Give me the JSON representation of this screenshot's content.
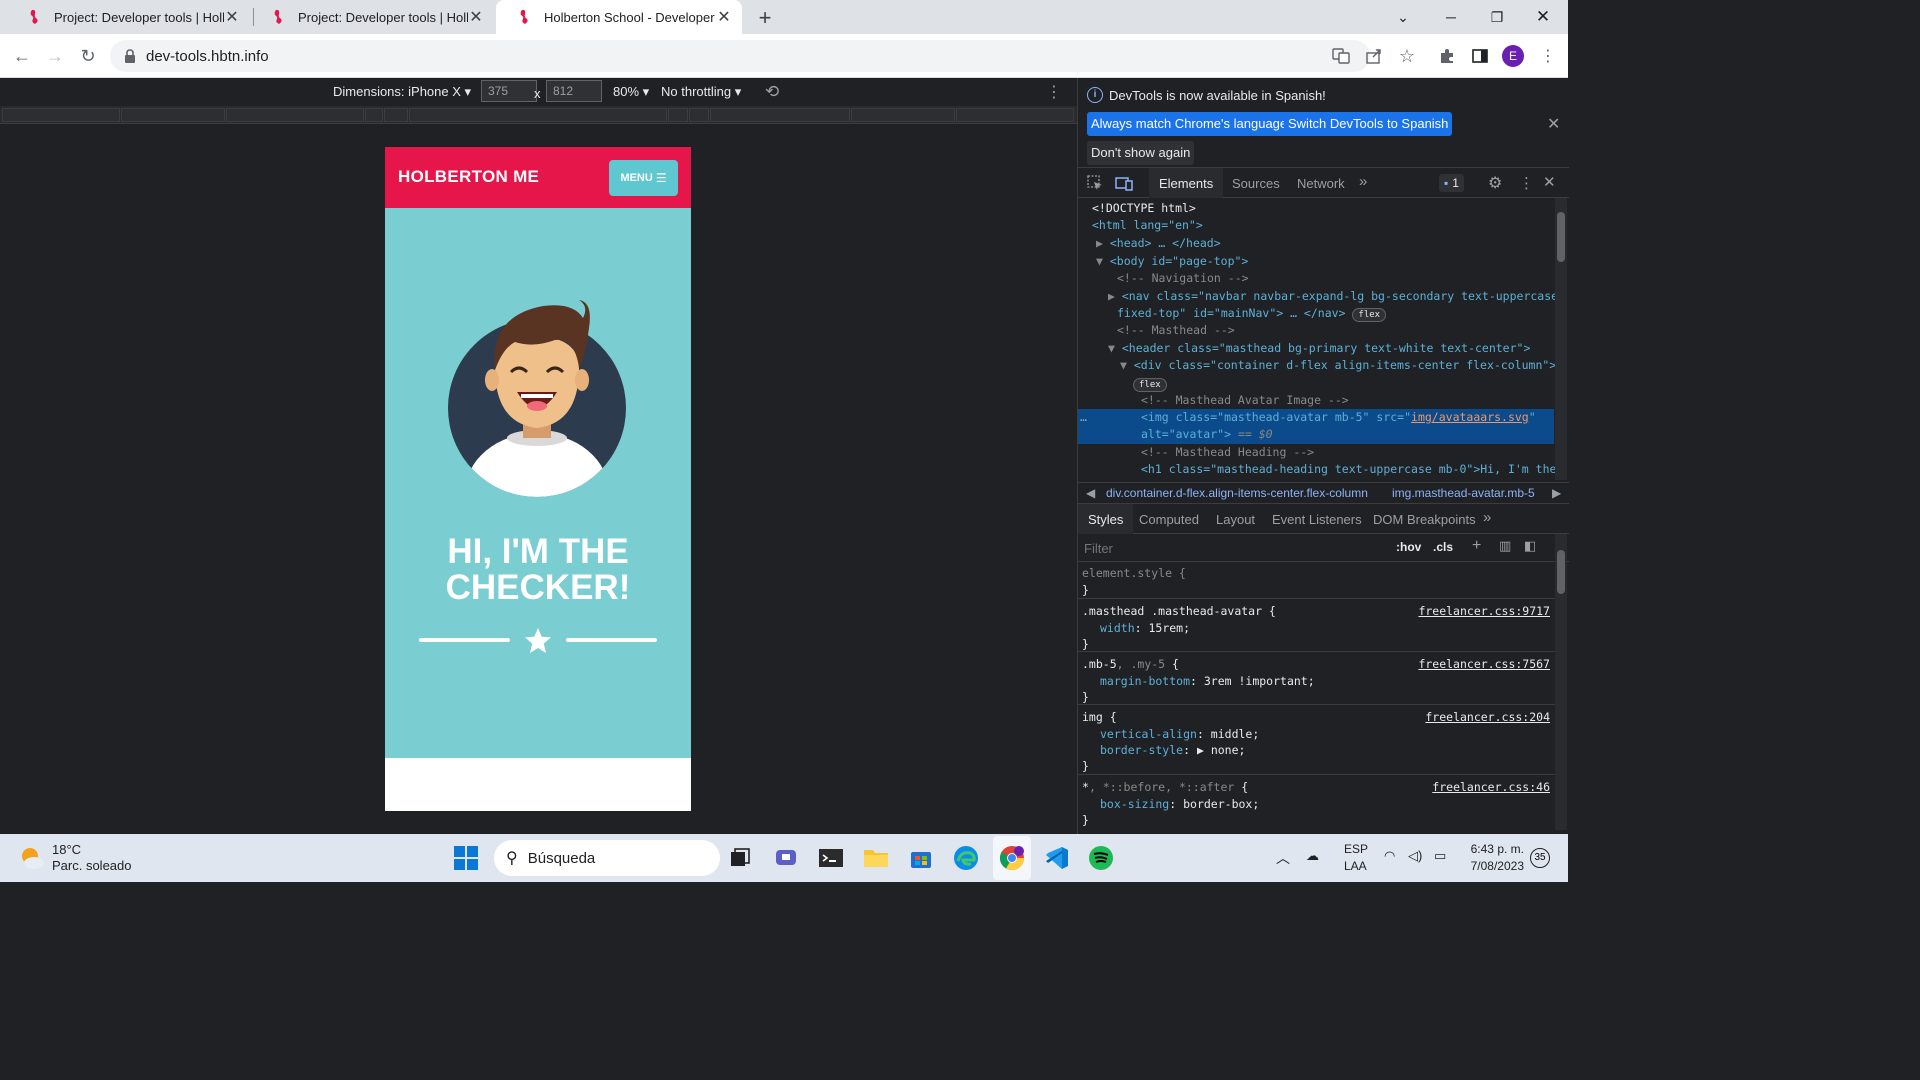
{
  "tabs": [
    {
      "title": "Project: Developer tools | Holberton",
      "active": false
    },
    {
      "title": "Project: Developer tools | Holberton",
      "active": false
    },
    {
      "title": "Holberton School - Developer tools",
      "active": true
    }
  ],
  "new_tab_label": "+",
  "address": {
    "url": "dev-tools.hbtn.info"
  },
  "profile_initial": "E",
  "device_toolbar": {
    "dimensions_label": "Dimensions: iPhone X",
    "width": "375",
    "height": "812",
    "times": "x",
    "zoom": "80%",
    "throttling": "No throttling"
  },
  "phone": {
    "brand": "HOLBERTON ME",
    "menu": "MENU",
    "heading_line1": "HI, I'M THE",
    "heading_line2": "CHECKER!"
  },
  "devtools": {
    "info_message": "DevTools is now available in Spanish!",
    "btn_match": "Always match Chrome's language",
    "btn_switch": "Switch DevTools to Spanish",
    "btn_dont_show": "Don't show again",
    "tabs": [
      "Elements",
      "Sources",
      "Network"
    ],
    "more_tabs": "»",
    "issues_count": "1",
    "dom_lines": {
      "doctype": "<!DOCTYPE html>",
      "html_open": "<html lang=\"en\">",
      "head_collapsed": "<head> … </head>",
      "body_open": "<body id=\"page-top\">",
      "cmt_navigation": "<!-- Navigation -->",
      "nav_line1": "<nav class=\"navbar navbar-expand-lg bg-secondary text-uppercase",
      "nav_line2": "fixed-top\" id=\"mainNav\"> … </nav>",
      "cmt_masthead": "<!-- Masthead -->",
      "header_open": "<header class=\"masthead bg-primary text-white text-center\">",
      "div_open": "<div class=\"container d-flex align-items-center flex-column\">",
      "cmt_avatar": "<!-- Masthead Avatar Image -->",
      "img_line1a": "<img class=\"masthead-avatar mb-5\" src=\"",
      "img_src": "img/avataaars.svg",
      "img_line1b": "\"",
      "img_line2": "alt=\"avatar\">",
      "img_eq": "== $0",
      "cmt_heading": "<!-- Masthead Heading -->",
      "h1_line": "<h1 class=\"masthead-heading text-uppercase mb-0\">Hi, I'm the",
      "flex_badge": "flex",
      "ellipsis": "…"
    },
    "breadcrumb": [
      "div.container.d-flex.align-items-center.flex-column",
      "img.masthead-avatar.mb-5"
    ],
    "styles_tabs": [
      "Styles",
      "Computed",
      "Layout",
      "Event Listeners",
      "DOM Breakpoints"
    ],
    "filter_placeholder": "Filter",
    "hov": ":hov",
    "cls": ".cls",
    "rules": {
      "element_style": "element.style {",
      "r1_sel": ".masthead .masthead-avatar {",
      "r1_prop": "width",
      "r1_val": "15rem;",
      "r1_src": "freelancer.css:9717",
      "r2_sel": ".mb-5",
      "r2_sel_dim": ", .my-5",
      "r2_brace": " {",
      "r2_prop": "margin-bottom",
      "r2_val": "3rem !important;",
      "r2_src": "freelancer.css:7567",
      "r3_sel": "img {",
      "r3_prop1": "vertical-align",
      "r3_val1": "middle;",
      "r3_prop2": "border-style",
      "r3_val2": "none;",
      "r3_src": "freelancer.css:204",
      "r4_sel": "*",
      "r4_sel_dim": ", *::before, *::after",
      "r4_brace": " {",
      "r4_prop": "box-sizing",
      "r4_val": "border-box;",
      "r4_src": "freelancer.css:46",
      "close": "}"
    }
  },
  "taskbar": {
    "weather_temp": "18°C",
    "weather_desc": "Parc. soleado",
    "search_label": "Búsqueda",
    "lang1": "ESP",
    "lang2": "LAA",
    "time": "6:43 p. m.",
    "date": "7/08/2023",
    "notif_count": "35"
  },
  "colors": {
    "brand_red": "#e6164b",
    "masthead_teal": "#7acdd1",
    "menu_teal": "#5fc7cf",
    "devtools_bg": "#202124",
    "accent_blue": "#1a73e8"
  }
}
